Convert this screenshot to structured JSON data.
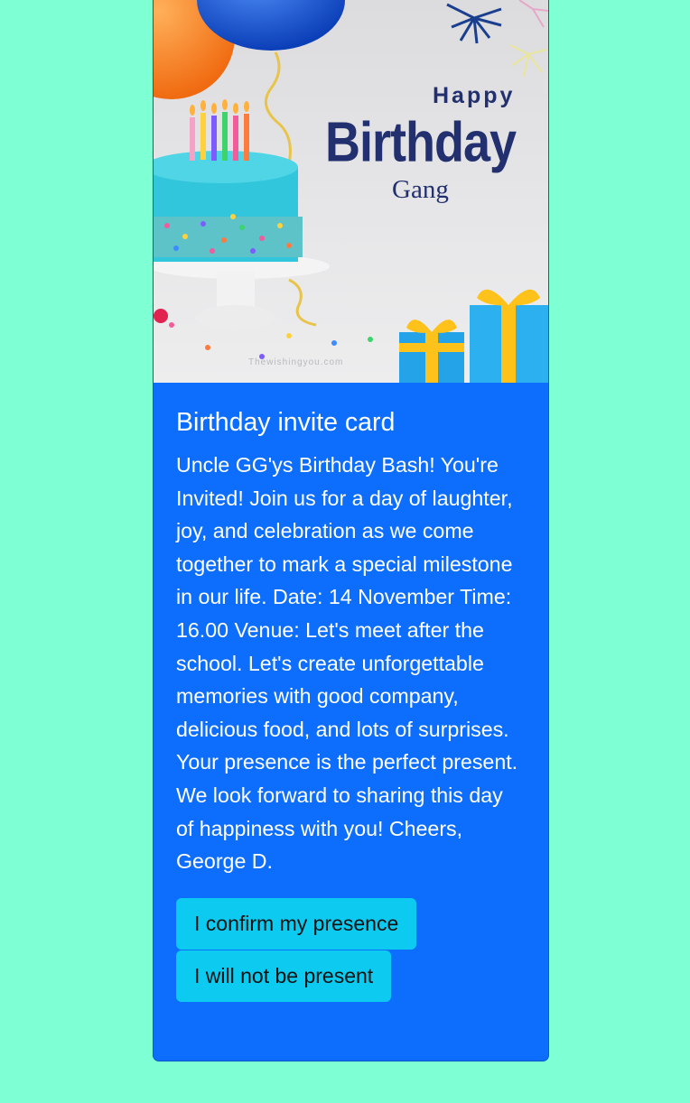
{
  "card": {
    "image": {
      "alt_words": {
        "happy": "Happy",
        "birthday": "Birthday",
        "gang": "Gang"
      },
      "watermark": "Thewishingyou.com"
    },
    "title": "Birthday invite card",
    "text": "Uncle GG'ys Birthday Bash! You're Invited! Join us for a day of laughter, joy, and celebration as we come together to mark a special milestone in our life. Date: 14 November Time: 16.00 Venue: Let's meet after the school. Let's create unforgettable memories with good company, delicious food, and lots of surprises. Your presence is the perfect present. We look forward to sharing this day of happiness with you! Cheers, George D.",
    "buttons": {
      "confirm": "I confirm my presence",
      "decline": "I will not be present"
    }
  },
  "colors": {
    "page_background": "#7fffd4",
    "card_background": "#0d6efd",
    "button_background": "#0dcaf0",
    "title_text": "#22306f"
  }
}
